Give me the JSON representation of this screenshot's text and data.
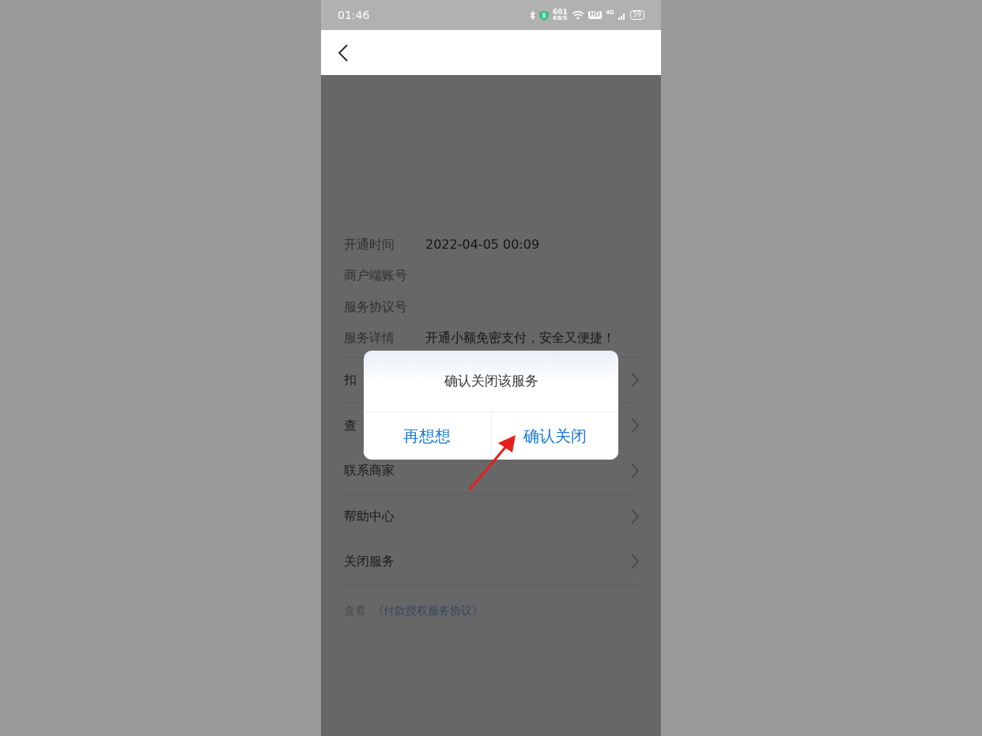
{
  "status_bar": {
    "time": "01:46",
    "speed_value": "601",
    "speed_unit": "KB/S",
    "hd": "HD",
    "network": "4G",
    "battery": "59"
  },
  "info": [
    {
      "label": "开通时间",
      "value": "2022-04-05 00:09"
    },
    {
      "label": "商户端账号"
    },
    {
      "label": "服务协议号"
    },
    {
      "label": "服务详情",
      "value": "开通小额免密支付，安全又便捷！"
    }
  ],
  "menu": [
    {
      "label": "扣"
    },
    {
      "label": "查"
    },
    {
      "label": "联系商家"
    },
    {
      "label": "帮助中心"
    },
    {
      "label": "关闭服务"
    }
  ],
  "footer": {
    "prefix": "查看",
    "link": "《付款授权服务协议》"
  },
  "dialog": {
    "message": "确认关闭该服务",
    "buttons": [
      {
        "label": "再想想"
      },
      {
        "label": "确认关闭"
      }
    ]
  },
  "annotation": {
    "kind": "arrow"
  }
}
